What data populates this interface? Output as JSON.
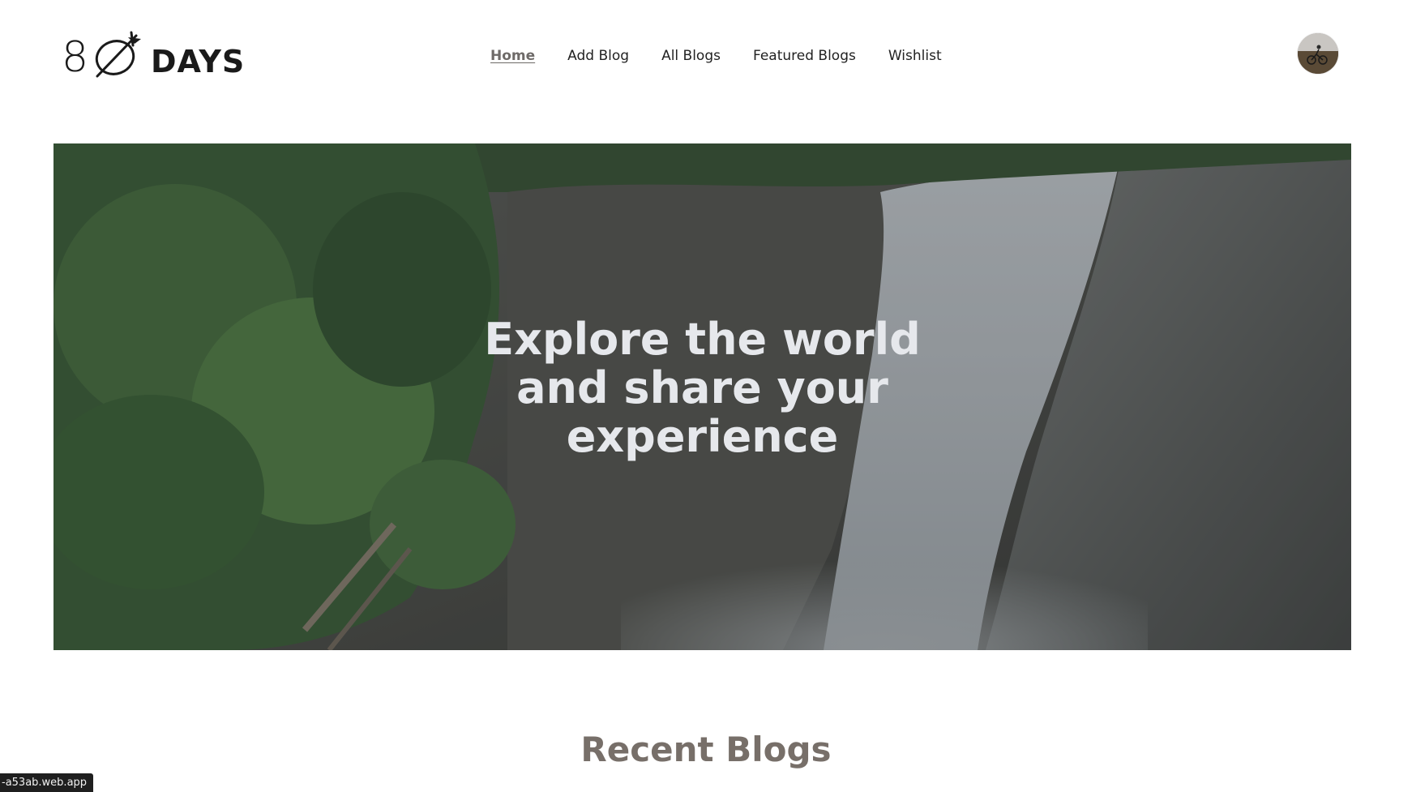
{
  "brand": {
    "logo_numeral": "8",
    "logo_word": "DAYS"
  },
  "nav": {
    "items": [
      {
        "label": "Home",
        "active": true
      },
      {
        "label": "Add Blog",
        "active": false
      },
      {
        "label": "All Blogs",
        "active": false
      },
      {
        "label": "Featured Blogs",
        "active": false
      },
      {
        "label": "Wishlist",
        "active": false
      }
    ]
  },
  "user": {
    "avatar_icon": "user-avatar"
  },
  "hero": {
    "title_lines": [
      "Explore the world",
      "and share your",
      "experience"
    ]
  },
  "recent": {
    "title": "Recent Blogs"
  },
  "status_bar": {
    "url": "-a53ab.web.app"
  },
  "colors": {
    "nav_active": "#6e6a68",
    "hero_text": "#e6e8ec",
    "section_title": "#776f69"
  }
}
